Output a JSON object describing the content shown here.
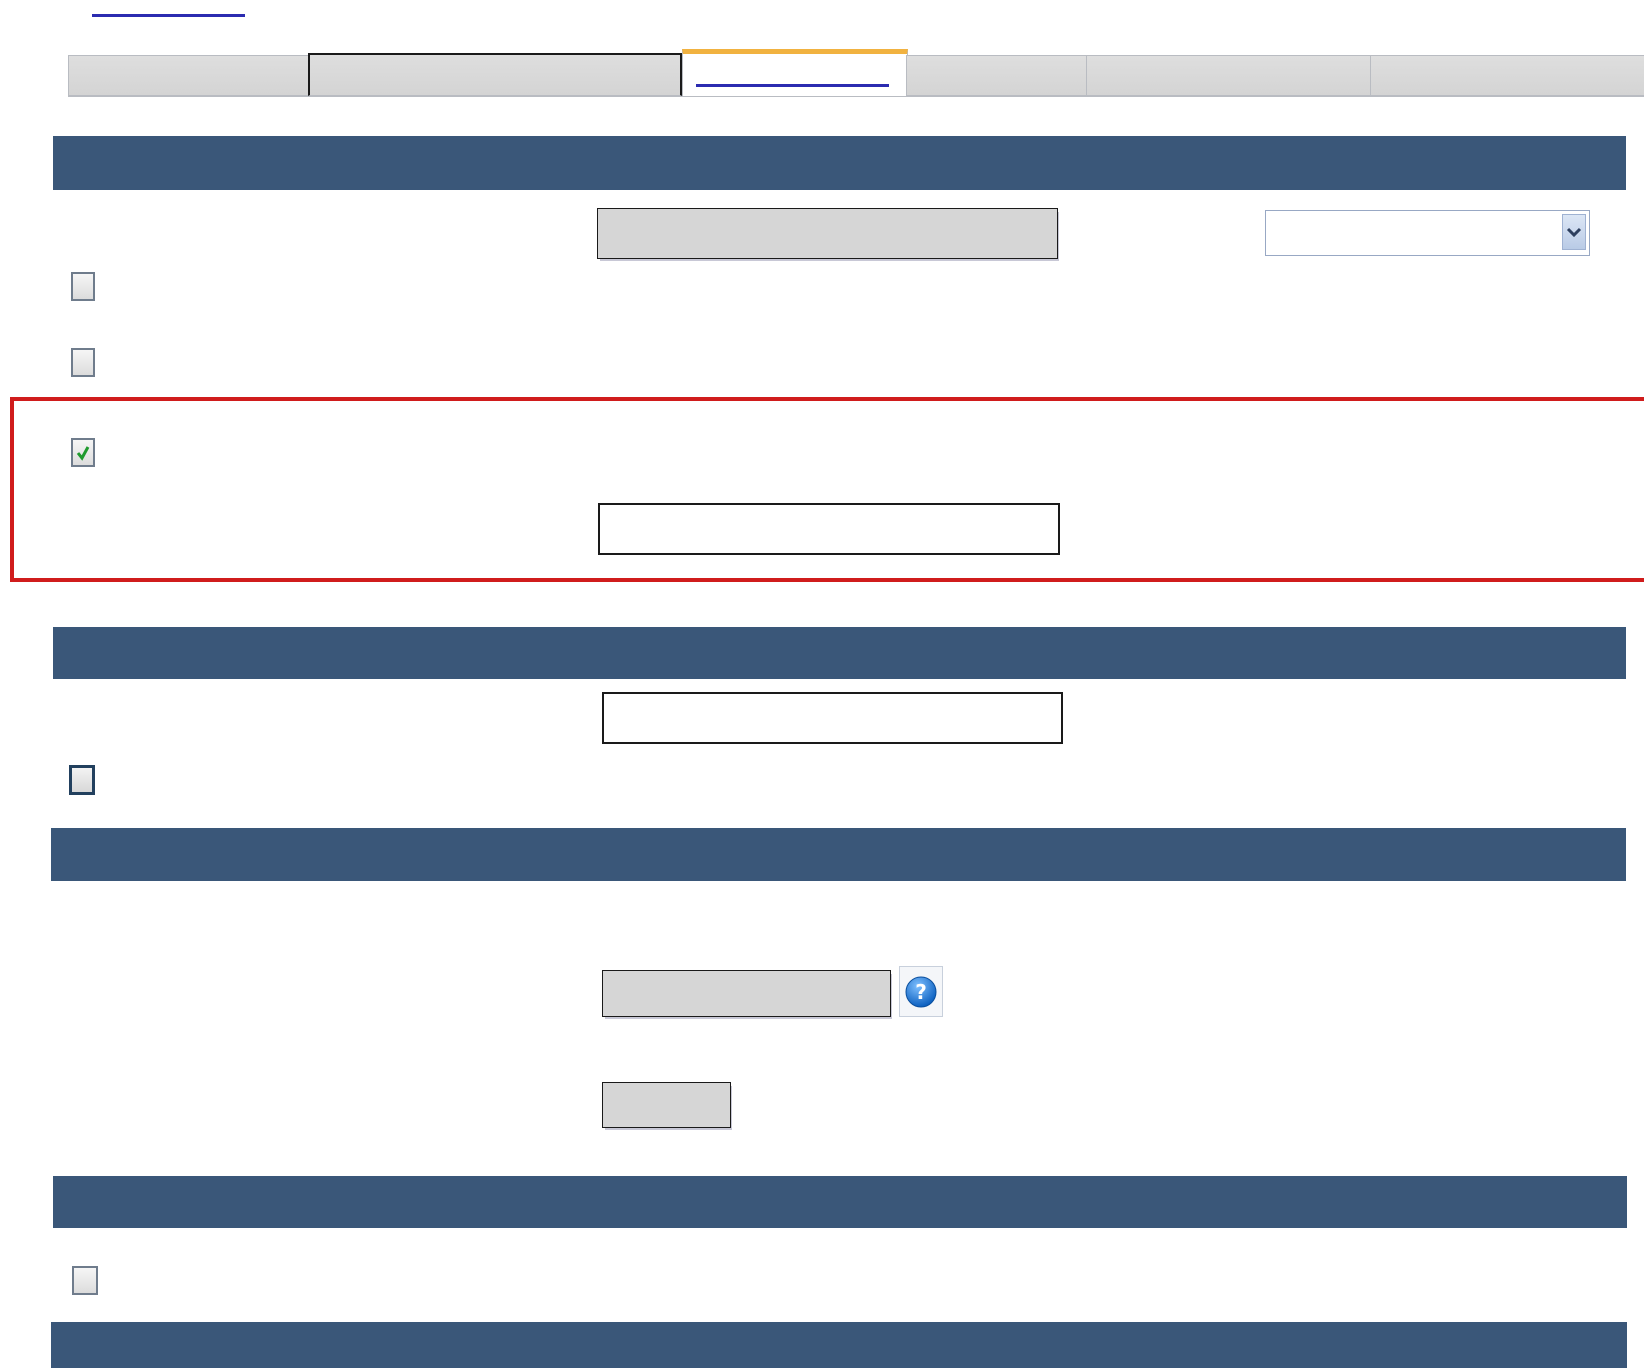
{
  "tabs": {
    "items": [
      "",
      "",
      "",
      "",
      "",
      ""
    ],
    "active_index": 2
  },
  "colors": {
    "section_bar": "#3a5779",
    "active_tab_top": "#f1b240",
    "link_blue": "#2b2bb0",
    "highlight_border": "#d01c1c",
    "readonly_field": "#d6d6d6"
  },
  "section_1": {
    "readonly_value": "",
    "select_value": "",
    "checkbox_1_checked": false,
    "checkbox_2_checked": false,
    "checkbox_3_checked": true,
    "text_input_value": ""
  },
  "section_2": {
    "text_input_value": "",
    "checkbox_checked": false
  },
  "section_3": {
    "readonly_value": "",
    "small_field_value": ""
  },
  "section_4": {
    "checkbox_checked": false
  },
  "icons": {
    "select_arrow": "chevron-down-icon",
    "checkmark": "checkmark-icon",
    "help": "help-icon"
  }
}
